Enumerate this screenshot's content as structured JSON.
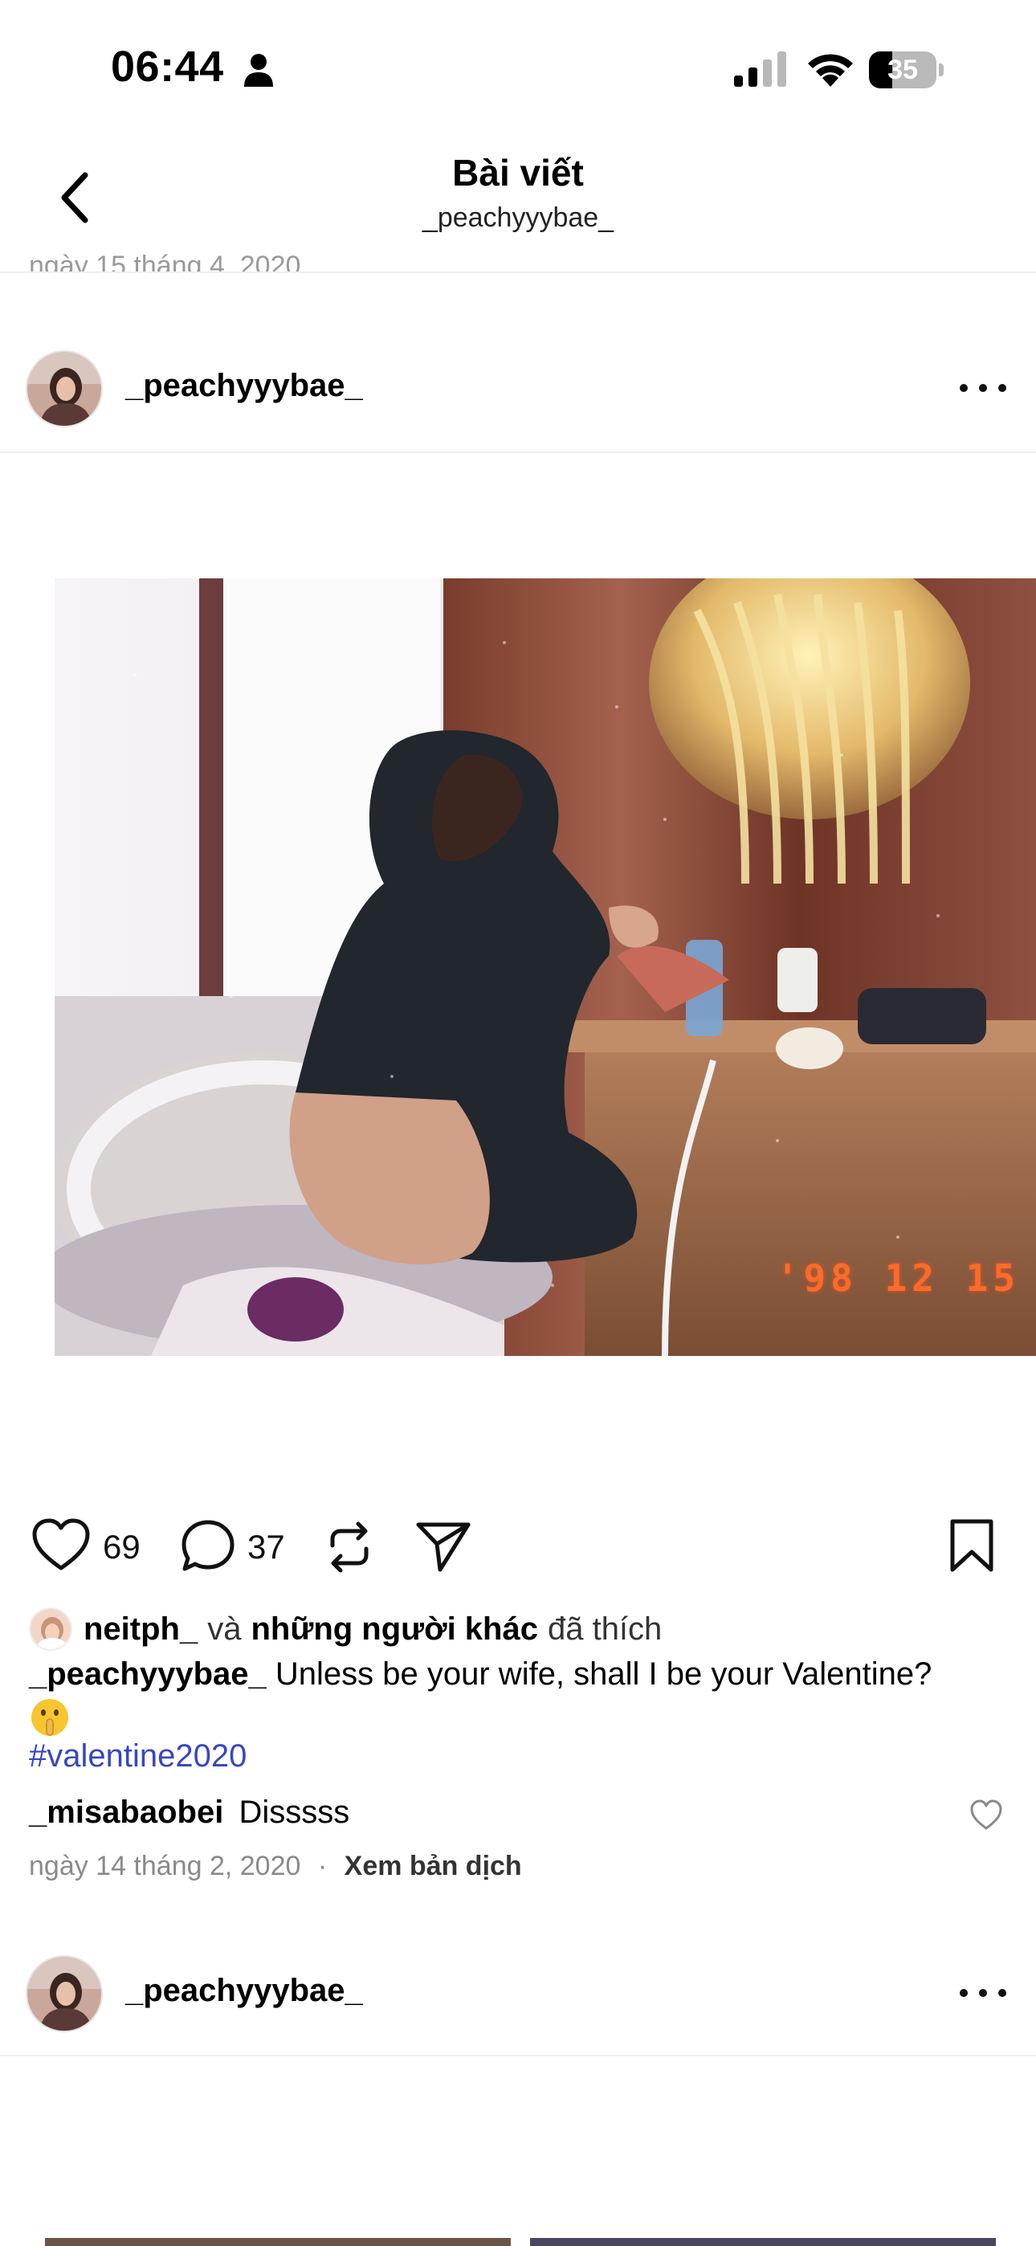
{
  "status_bar": {
    "time": "06:44",
    "battery_level": "35",
    "icons": [
      "person-icon",
      "signal-icon",
      "wifi-icon",
      "battery-icon"
    ]
  },
  "nav": {
    "title": "Bài viết",
    "subtitle": "_peachyyybae_",
    "clipped_previous_date": "ngày 15 tháng 4, 2020"
  },
  "post": {
    "username": "_peachyyybae_",
    "photo_date_stamp": "'98 12 15",
    "likes": "69",
    "comments": "37",
    "liked_by": {
      "user": "neitph_",
      "conjunction": "và",
      "others": "những người khác",
      "suffix": "đã thích"
    },
    "caption": {
      "username": "_peachyyybae_",
      "text": "Unless be your wife, shall I be your Valentine?",
      "hashtag": "#valentine2020"
    },
    "top_comment": {
      "username": "_misabaobei",
      "text": "Disssss"
    },
    "date": "ngày 14 tháng 2, 2020",
    "separator": "·",
    "translate_label": "Xem bản dịch"
  },
  "next_post": {
    "username": "_peachyyybae_"
  },
  "colors": {
    "hashtag": "#3747c2",
    "muted": "#8a8a8a",
    "divider": "#efefef",
    "date_stamp": "#ff6a2a"
  }
}
